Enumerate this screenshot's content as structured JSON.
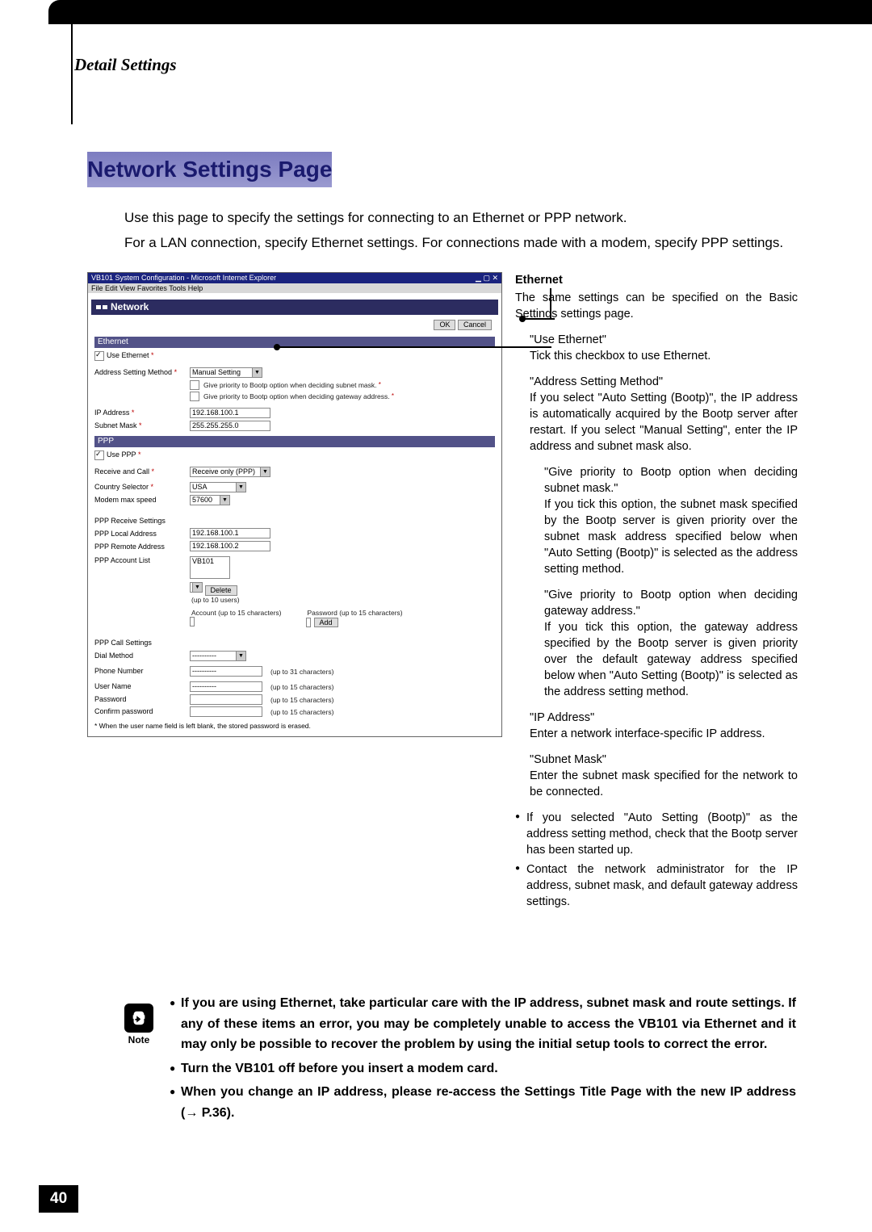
{
  "header": {
    "section_title": "Detail Settings",
    "page_heading": "Network Settings Page"
  },
  "lead": {
    "p1": "Use this page to specify the settings for connecting to an Ethernet or PPP network.",
    "p2": "For a LAN connection, specify Ethernet settings. For connections made with a modem, specify PPP settings."
  },
  "screenshot": {
    "window_title": "VB101 System Configuration - Microsoft Internet Explorer",
    "menubar": "File  Edit  View  Favorites  Tools  Help",
    "page_title": "Network",
    "ok_label": "OK",
    "cancel_label": "Cancel",
    "ethernet": {
      "bar": "Ethernet",
      "use_label": "Use Ethernet",
      "addr_method_label": "Address Setting Method",
      "addr_method_value": "Manual Setting",
      "bootp_mask": "Give priority to Bootp option when deciding subnet mask.",
      "bootp_gw": "Give priority to Bootp option when deciding gateway address.",
      "ip_label": "IP Address",
      "ip_value": "192.168.100.1",
      "mask_label": "Subnet Mask",
      "mask_value": "255.255.255.0"
    },
    "ppp": {
      "bar": "PPP",
      "use_label": "Use PPP",
      "rc_label": "Receive and Call",
      "rc_value": "Receive only (PPP)",
      "country_label": "Country Selector",
      "country_value": "USA",
      "modem_label": "Modem max speed",
      "modem_value": "57600",
      "recv_title": "PPP Receive Settings",
      "local_label": "PPP Local Address",
      "local_value": "192.168.100.1",
      "remote_label": "PPP Remote Address",
      "remote_value": "192.168.100.2",
      "acct_list_label": "PPP Account List",
      "acct_list_value": "VB101",
      "delete_label": "Delete",
      "limit_users": "(up to 10 users)",
      "account_label": "Account (up to 15 characters)",
      "password_label": "Password (up to 15 characters)",
      "add_label": "Add",
      "call_title": "PPP Call Settings",
      "dial_label": "Dial Method",
      "dial_value": "----------",
      "phone_label": "Phone Number",
      "phone_hint": "(up to 31 characters)",
      "user_label": "User Name",
      "pw_label": "Password",
      "cpw_label": "Confirm password",
      "char_hint": "(up to 15 characters)",
      "footnote": "* When the user name field is left blank, the stored password is erased."
    }
  },
  "rh": {
    "eth_h": "Ethernet",
    "eth_p": "The same settings can be specified on the Basic Settings settings page.",
    "use_h": "\"Use Ethernet\"",
    "use_p": "Tick this checkbox to use Ethernet.",
    "asm_h": "\"Address Setting Method\"",
    "asm_p": "If you select \"Auto Setting (Bootp)\", the IP address is automatically acquired by the Bootp server after restart. If you select \"Manual Setting\", enter the IP address and subnet mask also.",
    "bm_h": "\"Give priority to Bootp option when deciding subnet mask.\"",
    "bm_p": "If you tick this option, the subnet mask specified by the Bootp server is given priority over the subnet mask address specified below when \"Auto Setting (Bootp)\" is selected as the address setting method.",
    "bg_h": "\"Give priority to Bootp option when deciding gateway address.\"",
    "bg_p": "If you tick this option, the gateway address specified by the Bootp server is given priority over the default gateway address specified below when \"Auto Setting (Bootp)\" is selected as the address setting method.",
    "ip_h": "\"IP Address\"",
    "ip_p": "Enter a network interface-specific IP address.",
    "sm_h": "\"Subnet Mask\"",
    "sm_p": "Enter the subnet mask specified for the network to be connected.",
    "b1": "If you selected \"Auto Setting (Bootp)\" as the address setting method, check that the Bootp server has been started up.",
    "b2": "Contact the network administrator for the IP address, subnet mask, and default gateway address settings."
  },
  "note": {
    "label": "Note",
    "n1": "If you are using Ethernet, take particular care with the IP address, subnet mask and route settings. If any of these items an error, you may be completely unable to access the VB101 via Ethernet and it may only be possible to recover the problem by using the initial setup tools to correct the error.",
    "n2": "Turn the VB101 off before you insert a modem card.",
    "n3": "When you change an IP address, please re-access the Settings Title Page with the new IP address (→ P.36)."
  },
  "pagenum": "40"
}
